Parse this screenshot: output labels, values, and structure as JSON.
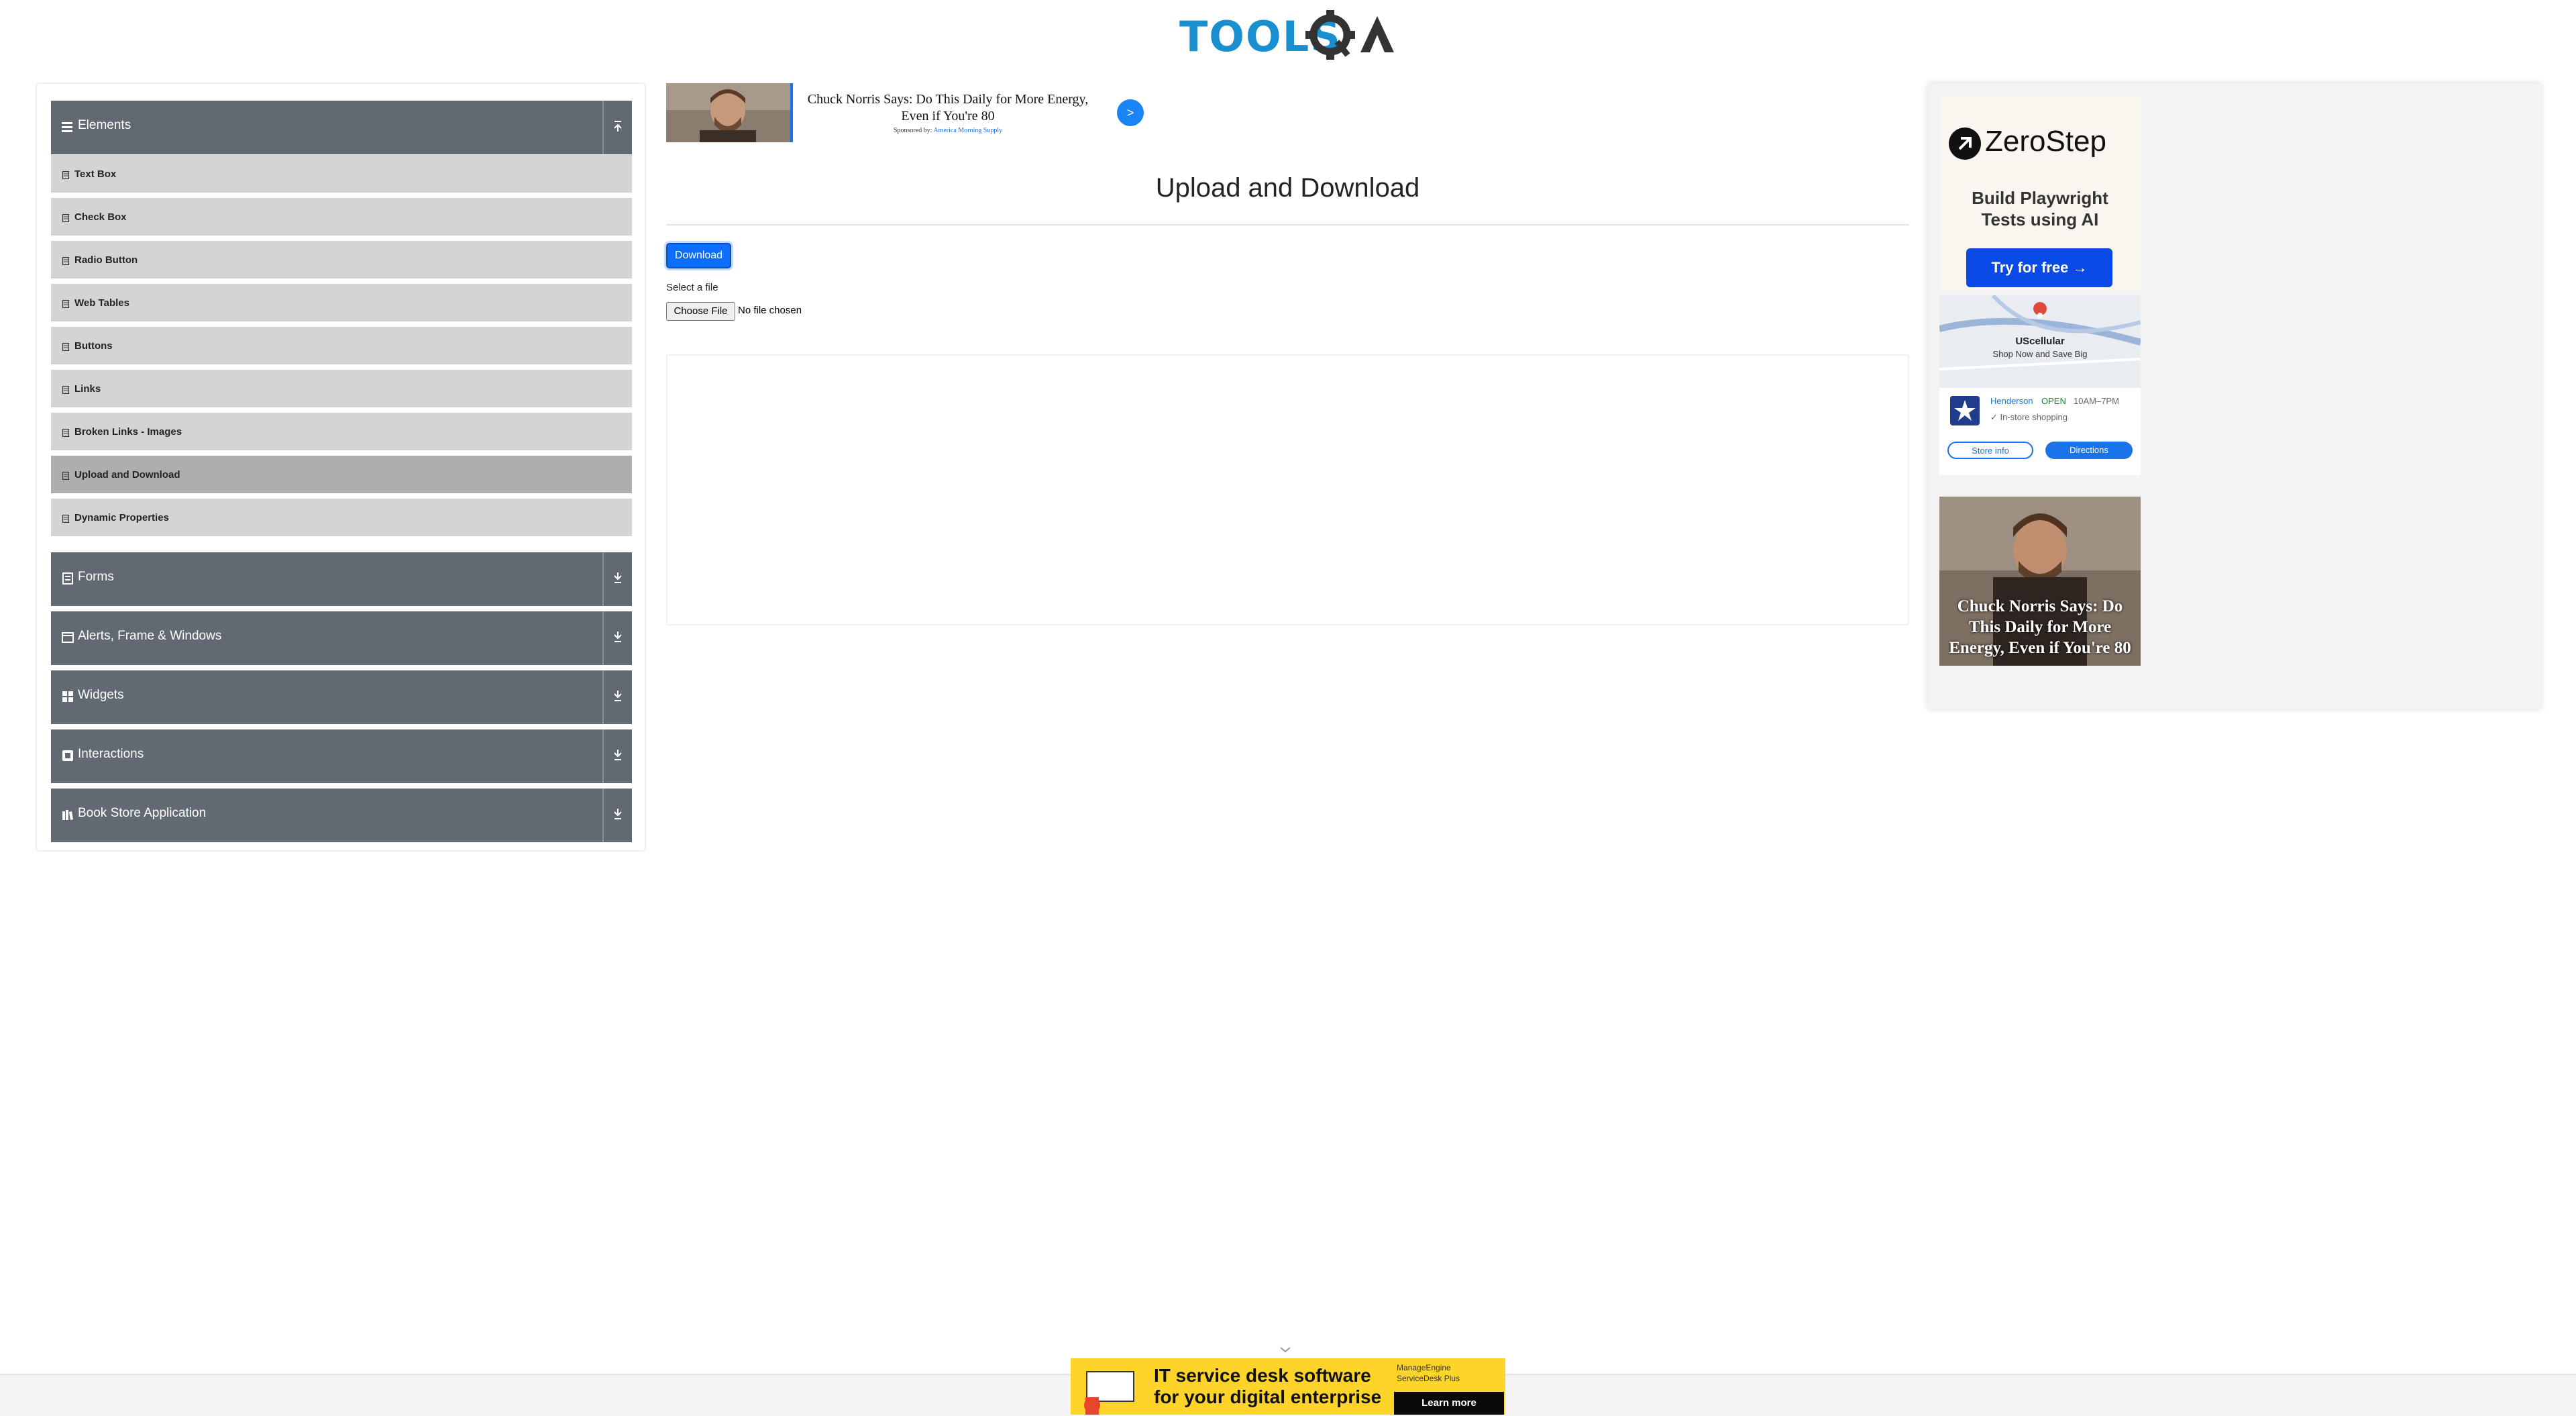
{
  "header": {
    "logo_text": "TOOLSQA"
  },
  "sidebar": {
    "groups": [
      {
        "title": "Elements"
      },
      {
        "title": "Forms"
      },
      {
        "title": "Alerts, Frame & Windows"
      },
      {
        "title": "Widgets"
      },
      {
        "title": "Interactions"
      },
      {
        "title": "Book Store Application"
      }
    ],
    "elements_items": [
      {
        "label": "Text Box"
      },
      {
        "label": "Check Box"
      },
      {
        "label": "Radio Button"
      },
      {
        "label": "Web Tables"
      },
      {
        "label": "Buttons"
      },
      {
        "label": "Links"
      },
      {
        "label": "Broken Links - Images"
      },
      {
        "label": "Upload and Download"
      },
      {
        "label": "Dynamic Properties"
      }
    ],
    "active_item": "Upload and Download"
  },
  "top_ad": {
    "title": "Chuck Norris Says: Do This Daily for More Energy, Even if You're 80",
    "sponsored_prefix": "Sponsored by:",
    "sponsor": "America Morning Supply",
    "go_label": ">"
  },
  "main": {
    "title": "Upload and Download",
    "download_label": "Download",
    "select_label": "Select a file",
    "choose_label": "Choose File",
    "file_status": "No file chosen"
  },
  "right_ad": {
    "zerostep": {
      "brand": "ZeroStep",
      "line1": "Build Playwright",
      "line2": "Tests using AI",
      "cta": "Try for free →"
    },
    "map": {
      "place": "UScellular",
      "sub": "Shop Now and Save Big",
      "name": "Henderson",
      "open": "OPEN",
      "hours": "10AM–7PM",
      "shopping": "✓ In-store shopping",
      "store_info": "Store info",
      "directions": "Directions"
    },
    "promo_caption": "Chuck Norris Says: Do This Daily for More Energy, Even if You're 80"
  },
  "bottom_ad": {
    "line1": "IT service desk software",
    "line2": "for your digital enterprise",
    "brand1": "ManageEngine",
    "brand2": "ServiceDesk Plus",
    "learn": "Learn more"
  },
  "colors": {
    "brand": "#1a8fd0",
    "group_bg": "#616972",
    "item_bg": "#d4d4d4",
    "item_active_bg": "#aeaeae",
    "primary": "#0d6efd"
  }
}
